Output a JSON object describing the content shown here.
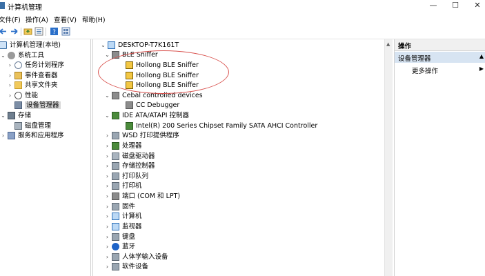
{
  "window": {
    "title": "计算机管理",
    "minimize_glyph": "—",
    "maximize_glyph": "☐",
    "close_glyph": "✕"
  },
  "menubar": {
    "items": [
      "文件(F)",
      "操作(A)",
      "查看(V)",
      "帮助(H)"
    ]
  },
  "toolbar": {
    "icons": [
      "back-icon",
      "forward-icon",
      "folder-up-icon",
      "properties-icon",
      "help-icon",
      "view-icon"
    ]
  },
  "left_tree": {
    "items": [
      {
        "label": "计算机管理(本地)",
        "chev": "",
        "icon": "computer-icon"
      },
      {
        "label": "系统工具",
        "chev": "⌄",
        "icon": "tools-icon"
      },
      {
        "label": "任务计划程序",
        "chev": "›",
        "icon": "clock-icon"
      },
      {
        "label": "事件查看器",
        "chev": "›",
        "icon": "event-log-icon"
      },
      {
        "label": "共享文件夹",
        "chev": "›",
        "icon": "shared-folder-icon"
      },
      {
        "label": "性能",
        "chev": "›",
        "icon": "performance-icon"
      },
      {
        "label": "设备管理器",
        "chev": "",
        "icon": "device-manager-icon"
      },
      {
        "label": "存储",
        "chev": "⌄",
        "icon": "storage-icon"
      },
      {
        "label": "磁盘管理",
        "chev": "",
        "icon": "disk-icon"
      },
      {
        "label": "服务和应用程序",
        "chev": "›",
        "icon": "services-icon"
      }
    ]
  },
  "device_tree": {
    "items": [
      {
        "label": "DESKTOP-T7K161T",
        "chev": "⌄"
      },
      {
        "label": "BLE Sniffer",
        "chev": "⌄"
      },
      {
        "label": "Hollong BLE Sniffer",
        "chev": ""
      },
      {
        "label": "Hollong BLE Sniffer",
        "chev": ""
      },
      {
        "label": "Hollong BLE Sniffer",
        "chev": ""
      },
      {
        "label": "Cebal controlled devices",
        "chev": "⌄"
      },
      {
        "label": "CC Debugger",
        "chev": ""
      },
      {
        "label": "IDE ATA/ATAPI 控制器",
        "chev": "⌄"
      },
      {
        "label": "Intel(R) 200 Series Chipset Family SATA AHCI Controller",
        "chev": ""
      },
      {
        "label": "WSD 打印提供程序",
        "chev": "›"
      },
      {
        "label": "处理器",
        "chev": "›"
      },
      {
        "label": "磁盘驱动器",
        "chev": "›"
      },
      {
        "label": "存储控制器",
        "chev": "›"
      },
      {
        "label": "打印队列",
        "chev": "›"
      },
      {
        "label": "打印机",
        "chev": "›"
      },
      {
        "label": "端口 (COM 和 LPT)",
        "chev": "›"
      },
      {
        "label": "固件",
        "chev": "›"
      },
      {
        "label": "计算机",
        "chev": "›"
      },
      {
        "label": "监视器",
        "chev": "›"
      },
      {
        "label": "键盘",
        "chev": "›"
      },
      {
        "label": "蓝牙",
        "chev": "›"
      },
      {
        "label": "人体学输入设备",
        "chev": "›"
      },
      {
        "label": "软件设备",
        "chev": "›"
      }
    ]
  },
  "actions": {
    "header": "操作",
    "section": "设备管理器",
    "more": "更多操作",
    "arrow_up": "▲",
    "arrow_right": "▶"
  },
  "scroll": {
    "up_arrow": "▲"
  },
  "colors": {
    "selection": "#d9d9d9",
    "action_highlight": "#d7e4f2",
    "annotation_ellipse": "#d9534f"
  }
}
